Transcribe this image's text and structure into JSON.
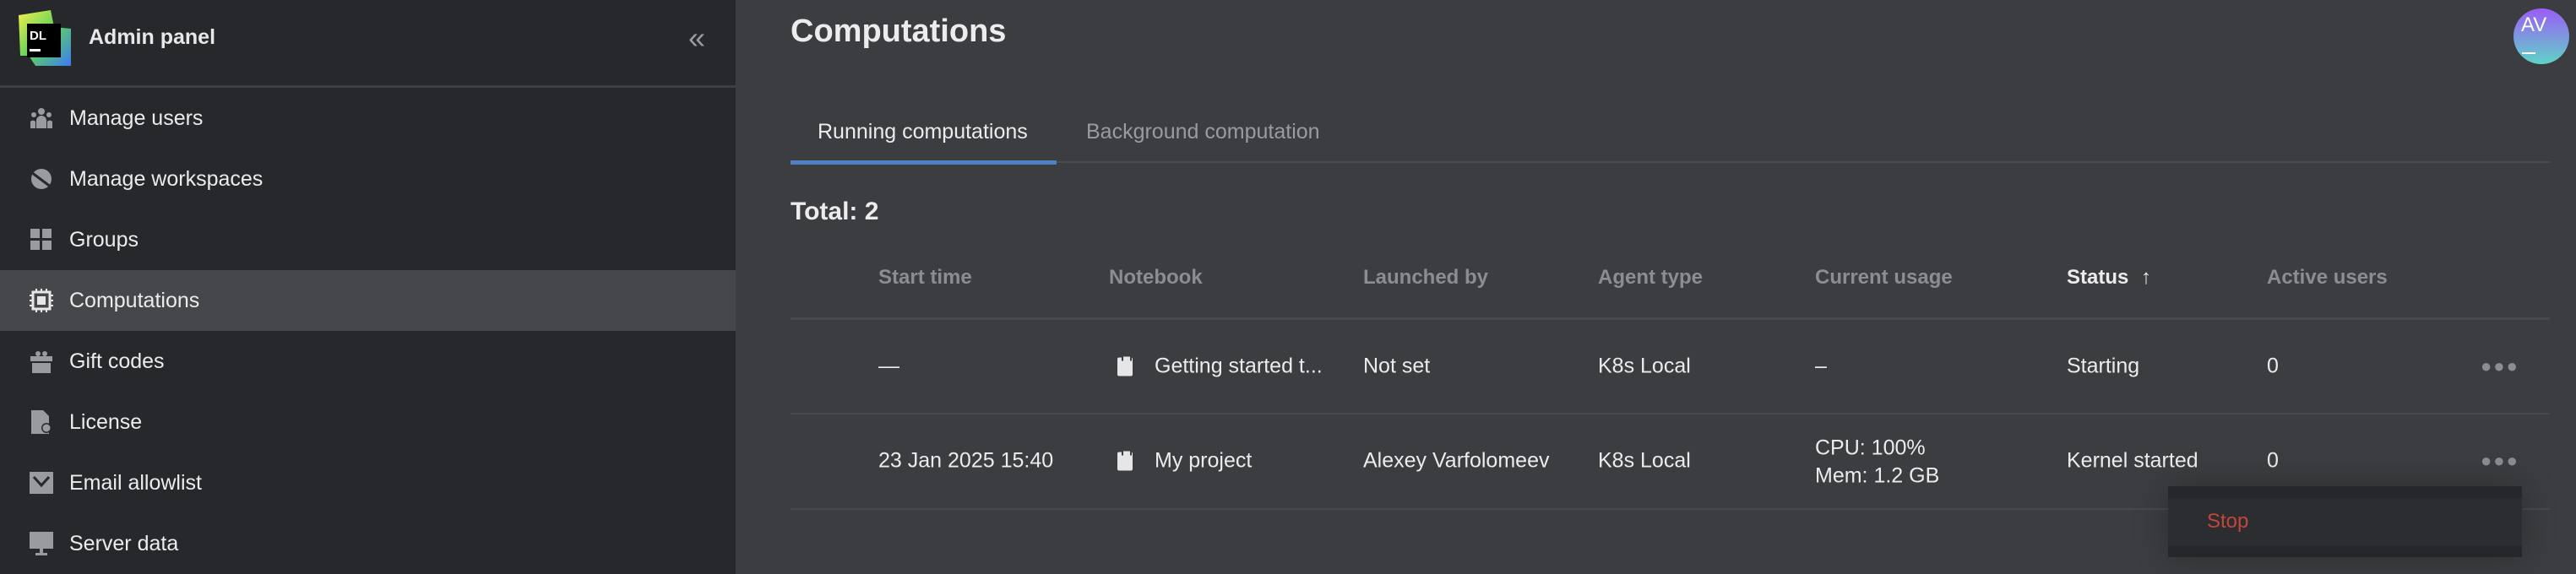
{
  "sidebar": {
    "brand": "Admin panel",
    "logo_text": "DL",
    "collapse_icon": "«",
    "items": [
      {
        "label": "Manage users",
        "icon": "users-icon"
      },
      {
        "label": "Manage workspaces",
        "icon": "workspace-icon"
      },
      {
        "label": "Groups",
        "icon": "grid-icon"
      },
      {
        "label": "Computations",
        "icon": "chip-icon",
        "selected": true
      },
      {
        "label": "Gift codes",
        "icon": "gift-icon"
      },
      {
        "label": "License",
        "icon": "license-icon"
      },
      {
        "label": "Email allowlist",
        "icon": "mail-icon"
      },
      {
        "label": "Server data",
        "icon": "monitor-icon"
      }
    ]
  },
  "main": {
    "title": "Computations",
    "avatar": "AV",
    "tabs": [
      {
        "label": "Running computations",
        "active": true
      },
      {
        "label": "Background computation"
      }
    ],
    "total": "Total: 2",
    "columns": [
      "Start time",
      "Notebook",
      "Launched by",
      "Agent type",
      "Current usage",
      "Status",
      "Active users"
    ],
    "sort_icon": "↑",
    "rows": [
      {
        "start": "—",
        "notebook": "Getting started t...",
        "launched_by": "Not set",
        "agent": "K8s Local",
        "usage1": "–",
        "usage2": "",
        "status": "Starting",
        "active": "0"
      },
      {
        "start": "23 Jan 2025 15:40",
        "notebook": "My project",
        "launched_by": "Alexey Varfolomeev",
        "agent": "K8s Local",
        "usage1": "CPU: 100%",
        "usage2": "Mem: 1.2 GB",
        "status": "Kernel started",
        "active": "0"
      }
    ],
    "menu": {
      "stop": "Stop"
    }
  },
  "colors": {
    "accent": "#4f7fbe",
    "danger": "#c2473a"
  }
}
